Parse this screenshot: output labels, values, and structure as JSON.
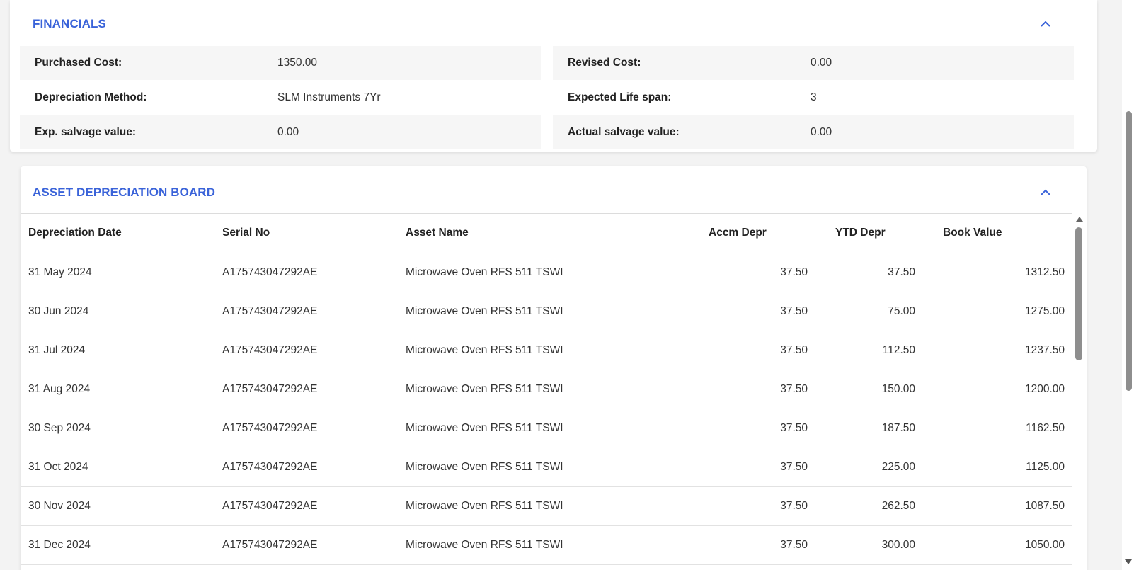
{
  "financials": {
    "title": "FINANCIALS",
    "left": [
      {
        "label": "Purchased Cost:",
        "value": "1350.00"
      },
      {
        "label": "Depreciation Method:",
        "value": "SLM Instruments 7Yr"
      },
      {
        "label": "Exp. salvage value:",
        "value": "0.00"
      }
    ],
    "right": [
      {
        "label": "Revised Cost:",
        "value": "0.00"
      },
      {
        "label": "Expected Life span:",
        "value": "3"
      },
      {
        "label": "Actual salvage value:",
        "value": "0.00"
      }
    ]
  },
  "depreciation_board": {
    "title": "ASSET DEPRECIATION BOARD",
    "columns": [
      "Depreciation Date",
      "Serial No",
      "Asset Name",
      "Accm Depr",
      "YTD Depr",
      "Book Value"
    ],
    "rows": [
      [
        "31 May 2024",
        "A175743047292AE",
        "Microwave Oven RFS 511 TSWI",
        "37.50",
        "37.50",
        "1312.50"
      ],
      [
        "30 Jun 2024",
        "A175743047292AE",
        "Microwave Oven RFS 511 TSWI",
        "37.50",
        "75.00",
        "1275.00"
      ],
      [
        "31 Jul 2024",
        "A175743047292AE",
        "Microwave Oven RFS 511 TSWI",
        "37.50",
        "112.50",
        "1237.50"
      ],
      [
        "31 Aug 2024",
        "A175743047292AE",
        "Microwave Oven RFS 511 TSWI",
        "37.50",
        "150.00",
        "1200.00"
      ],
      [
        "30 Sep 2024",
        "A175743047292AE",
        "Microwave Oven RFS 511 TSWI",
        "37.50",
        "187.50",
        "1162.50"
      ],
      [
        "31 Oct 2024",
        "A175743047292AE",
        "Microwave Oven RFS 511 TSWI",
        "37.50",
        "225.00",
        "1125.00"
      ],
      [
        "30 Nov 2024",
        "A175743047292AE",
        "Microwave Oven RFS 511 TSWI",
        "37.50",
        "262.50",
        "1087.50"
      ],
      [
        "31 Dec 2024",
        "A175743047292AE",
        "Microwave Oven RFS 511 TSWI",
        "37.50",
        "300.00",
        "1050.00"
      ]
    ]
  },
  "icons": {
    "collapse": "chevron-up-icon",
    "scroll_up": "arrow-up-icon",
    "scroll_down": "arrow-down-icon"
  },
  "colors": {
    "accent": "#3a63d9",
    "row_shade": "#f6f6f6"
  }
}
